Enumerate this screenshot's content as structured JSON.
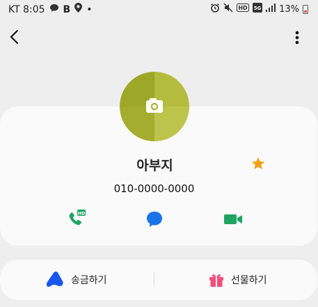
{
  "status_bar": {
    "carrier_time": "KT 8:05",
    "b_label": "B",
    "dot": "•",
    "battery_text": "13%",
    "left_icons": [
      "chat-icon",
      "map-pin-icon"
    ],
    "right_icons": [
      "alarm-icon",
      "mute-icon",
      "hd-icon",
      "5g-icon",
      "signal-icon",
      "battery-icon"
    ]
  },
  "header": {
    "back_icon": "chevron-left-icon",
    "more_icon": "more-vert-icon"
  },
  "contact": {
    "name": "아부지",
    "phone": "010-0000-0000",
    "avatar_icon": "camera-icon",
    "avatar_color": "#a8b230",
    "favorite_icon": "star-icon",
    "favorite_color": "#f29f15"
  },
  "actions": {
    "call_icon": "hd-phone-icon",
    "call_color": "#1fa463",
    "message_icon": "chat-bubble-icon",
    "message_color": "#1a73e8",
    "video_icon": "video-camera-icon",
    "video_color": "#1fa463"
  },
  "bottom": {
    "send_money_label": "송금하기",
    "send_money_icon": "toss-logo-icon",
    "gift_label": "선물하기",
    "gift_icon": "gift-icon",
    "gift_color": "#f0507a"
  }
}
